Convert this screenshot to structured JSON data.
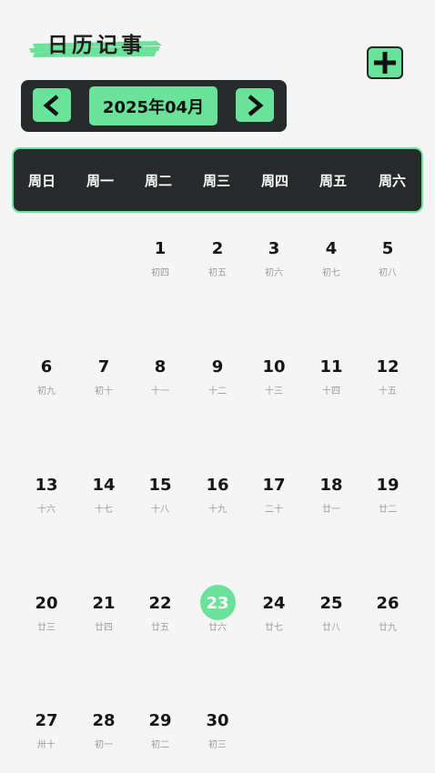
{
  "app": {
    "title": "日历记事",
    "accent": "#6be29a",
    "dark": "#272a2a"
  },
  "nav": {
    "month_label": "2025年04月",
    "prev_icon": "chevron-left-icon",
    "next_icon": "chevron-right-icon",
    "add_icon": "plus-icon"
  },
  "weekdays": [
    "周日",
    "周一",
    "周二",
    "周三",
    "周四",
    "周五",
    "周六"
  ],
  "days": [
    {
      "n": "1",
      "l": "初四",
      "col": 2,
      "row": 0
    },
    {
      "n": "2",
      "l": "初五",
      "col": 3,
      "row": 0
    },
    {
      "n": "3",
      "l": "初六",
      "col": 4,
      "row": 0
    },
    {
      "n": "4",
      "l": "初七",
      "col": 5,
      "row": 0
    },
    {
      "n": "5",
      "l": "初八",
      "col": 6,
      "row": 0
    },
    {
      "n": "6",
      "l": "初九",
      "col": 0,
      "row": 1
    },
    {
      "n": "7",
      "l": "初十",
      "col": 1,
      "row": 1
    },
    {
      "n": "8",
      "l": "十一",
      "col": 2,
      "row": 1
    },
    {
      "n": "9",
      "l": "十二",
      "col": 3,
      "row": 1
    },
    {
      "n": "10",
      "l": "十三",
      "col": 4,
      "row": 1
    },
    {
      "n": "11",
      "l": "十四",
      "col": 5,
      "row": 1
    },
    {
      "n": "12",
      "l": "十五",
      "col": 6,
      "row": 1
    },
    {
      "n": "13",
      "l": "十六",
      "col": 0,
      "row": 2
    },
    {
      "n": "14",
      "l": "十七",
      "col": 1,
      "row": 2
    },
    {
      "n": "15",
      "l": "十八",
      "col": 2,
      "row": 2
    },
    {
      "n": "16",
      "l": "十九",
      "col": 3,
      "row": 2
    },
    {
      "n": "17",
      "l": "二十",
      "col": 4,
      "row": 2
    },
    {
      "n": "18",
      "l": "廿一",
      "col": 5,
      "row": 2
    },
    {
      "n": "19",
      "l": "廿二",
      "col": 6,
      "row": 2
    },
    {
      "n": "20",
      "l": "廿三",
      "col": 0,
      "row": 3
    },
    {
      "n": "21",
      "l": "廿四",
      "col": 1,
      "row": 3
    },
    {
      "n": "22",
      "l": "廿五",
      "col": 2,
      "row": 3
    },
    {
      "n": "23",
      "l": "廿六",
      "col": 3,
      "row": 3,
      "today": true
    },
    {
      "n": "24",
      "l": "廿七",
      "col": 4,
      "row": 3
    },
    {
      "n": "25",
      "l": "廿八",
      "col": 5,
      "row": 3
    },
    {
      "n": "26",
      "l": "廿九",
      "col": 6,
      "row": 3
    },
    {
      "n": "27",
      "l": "卅十",
      "col": 0,
      "row": 4
    },
    {
      "n": "28",
      "l": "初一",
      "col": 1,
      "row": 4
    },
    {
      "n": "29",
      "l": "初二",
      "col": 2,
      "row": 4
    },
    {
      "n": "30",
      "l": "初三",
      "col": 3,
      "row": 4
    }
  ]
}
